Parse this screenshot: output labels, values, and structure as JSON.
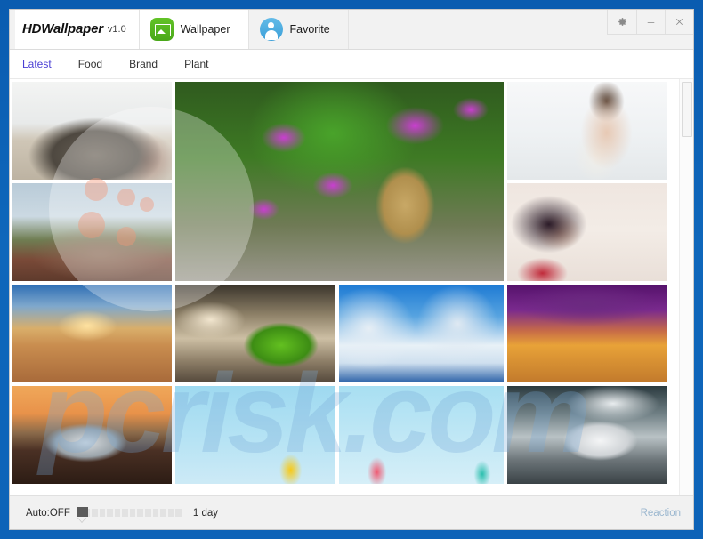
{
  "window": {
    "brand_name": "HDWallpaper",
    "version": "v1.0",
    "frame_color": "#0d63b8",
    "controls": [
      {
        "name": "settings",
        "glyph": "gear-icon"
      },
      {
        "name": "minimize",
        "glyph": "minimize-icon"
      },
      {
        "name": "close",
        "glyph": "close-icon"
      }
    ]
  },
  "tabs": [
    {
      "label": "Wallpaper",
      "icon": "wallpaper-icon",
      "active": true,
      "accent": "#4aa81a"
    },
    {
      "label": "Favorite",
      "icon": "user-icon",
      "active": false,
      "accent": "#3b9fd8"
    }
  ],
  "categories": [
    {
      "label": "Latest",
      "active": true,
      "color": "#4a3fd4"
    },
    {
      "label": "Food",
      "active": false,
      "color": "#333333"
    },
    {
      "label": "Brand",
      "active": false,
      "color": "#333333"
    },
    {
      "label": "Plant",
      "active": false,
      "color": "#333333"
    }
  ],
  "gallery": {
    "tiles": [
      {
        "id": "rock-coast",
        "alt": "Coastal rock formation with carved red characters"
      },
      {
        "id": "castle",
        "alt": "Castle on autumn hillside"
      },
      {
        "id": "danbo-flowers",
        "alt": "Cardboard robot among purple petunia flowers"
      },
      {
        "id": "girl-book",
        "alt": "Young woman holding an open book with plush toy"
      },
      {
        "id": "girl-red-lips",
        "alt": "Woman in white dress with red lipstick and rose"
      },
      {
        "id": "beach-sunset",
        "alt": "Beach sunset with driftwood"
      },
      {
        "id": "green-mustang",
        "alt": "Green Ford Mustang on a road at sunset"
      },
      {
        "id": "winter-trees",
        "alt": "Frost covered trees under blue winter sky"
      },
      {
        "id": "autumn-lake",
        "alt": "Purple sky over autumn lake reedbed"
      },
      {
        "id": "pagani",
        "alt": "Silver Pagani Huayra supercar at dusk"
      },
      {
        "id": "pastel-yellow",
        "alt": "Pastel blue backdrop with yellow wedge"
      },
      {
        "id": "pastel-pink",
        "alt": "Pastel blue backdrop with pink and teal wedges"
      },
      {
        "id": "white-mustang",
        "alt": "White Mustang drifting in smoke"
      }
    ]
  },
  "scrollbar": {
    "orientation": "vertical",
    "thumb_position": "top"
  },
  "status_bar": {
    "auto_label": "Auto:OFF",
    "interval_label": "1 day",
    "slider_segments": 14,
    "slider_value": 1,
    "reaction_label": "Reaction",
    "reaction_color": "#9bb7cf"
  },
  "watermark": {
    "text": "pcrisk.com"
  }
}
